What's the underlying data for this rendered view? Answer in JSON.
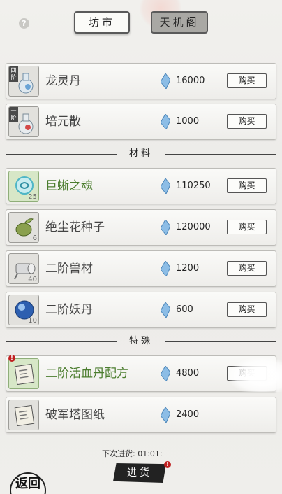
{
  "tabs": {
    "market": "坊市",
    "pavilion": "天机阁"
  },
  "items_top": [
    {
      "name": "龙灵丹",
      "grade": "四阶",
      "price": "16000",
      "buy": "购买"
    },
    {
      "name": "培元散",
      "grade": "一阶",
      "price": "1000",
      "buy": "购买"
    }
  ],
  "section_materials": "材料",
  "materials": [
    {
      "name": "巨蜥之魂",
      "count": "25",
      "price": "110250",
      "buy": "购买",
      "highlight": true
    },
    {
      "name": "绝尘花种子",
      "count": "6",
      "price": "120000",
      "buy": "购买"
    },
    {
      "name": "二阶兽材",
      "count": "40",
      "price": "1200",
      "buy": "购买"
    },
    {
      "name": "二阶妖丹",
      "count": "10",
      "price": "600",
      "buy": "购买"
    }
  ],
  "section_special": "特殊",
  "special": [
    {
      "name": "二阶活血丹配方",
      "price": "4800",
      "buy": "购买",
      "highlight": true
    },
    {
      "name": "破军塔图纸",
      "price": "2400"
    }
  ],
  "footer": {
    "next_restock": "下次进货: 01:01:",
    "restock": "进货",
    "back": "返回"
  },
  "colors": {
    "highlight_green": "#4b7d2e",
    "gem_blue": "#6aa4d6",
    "alert_red": "#c02020"
  }
}
